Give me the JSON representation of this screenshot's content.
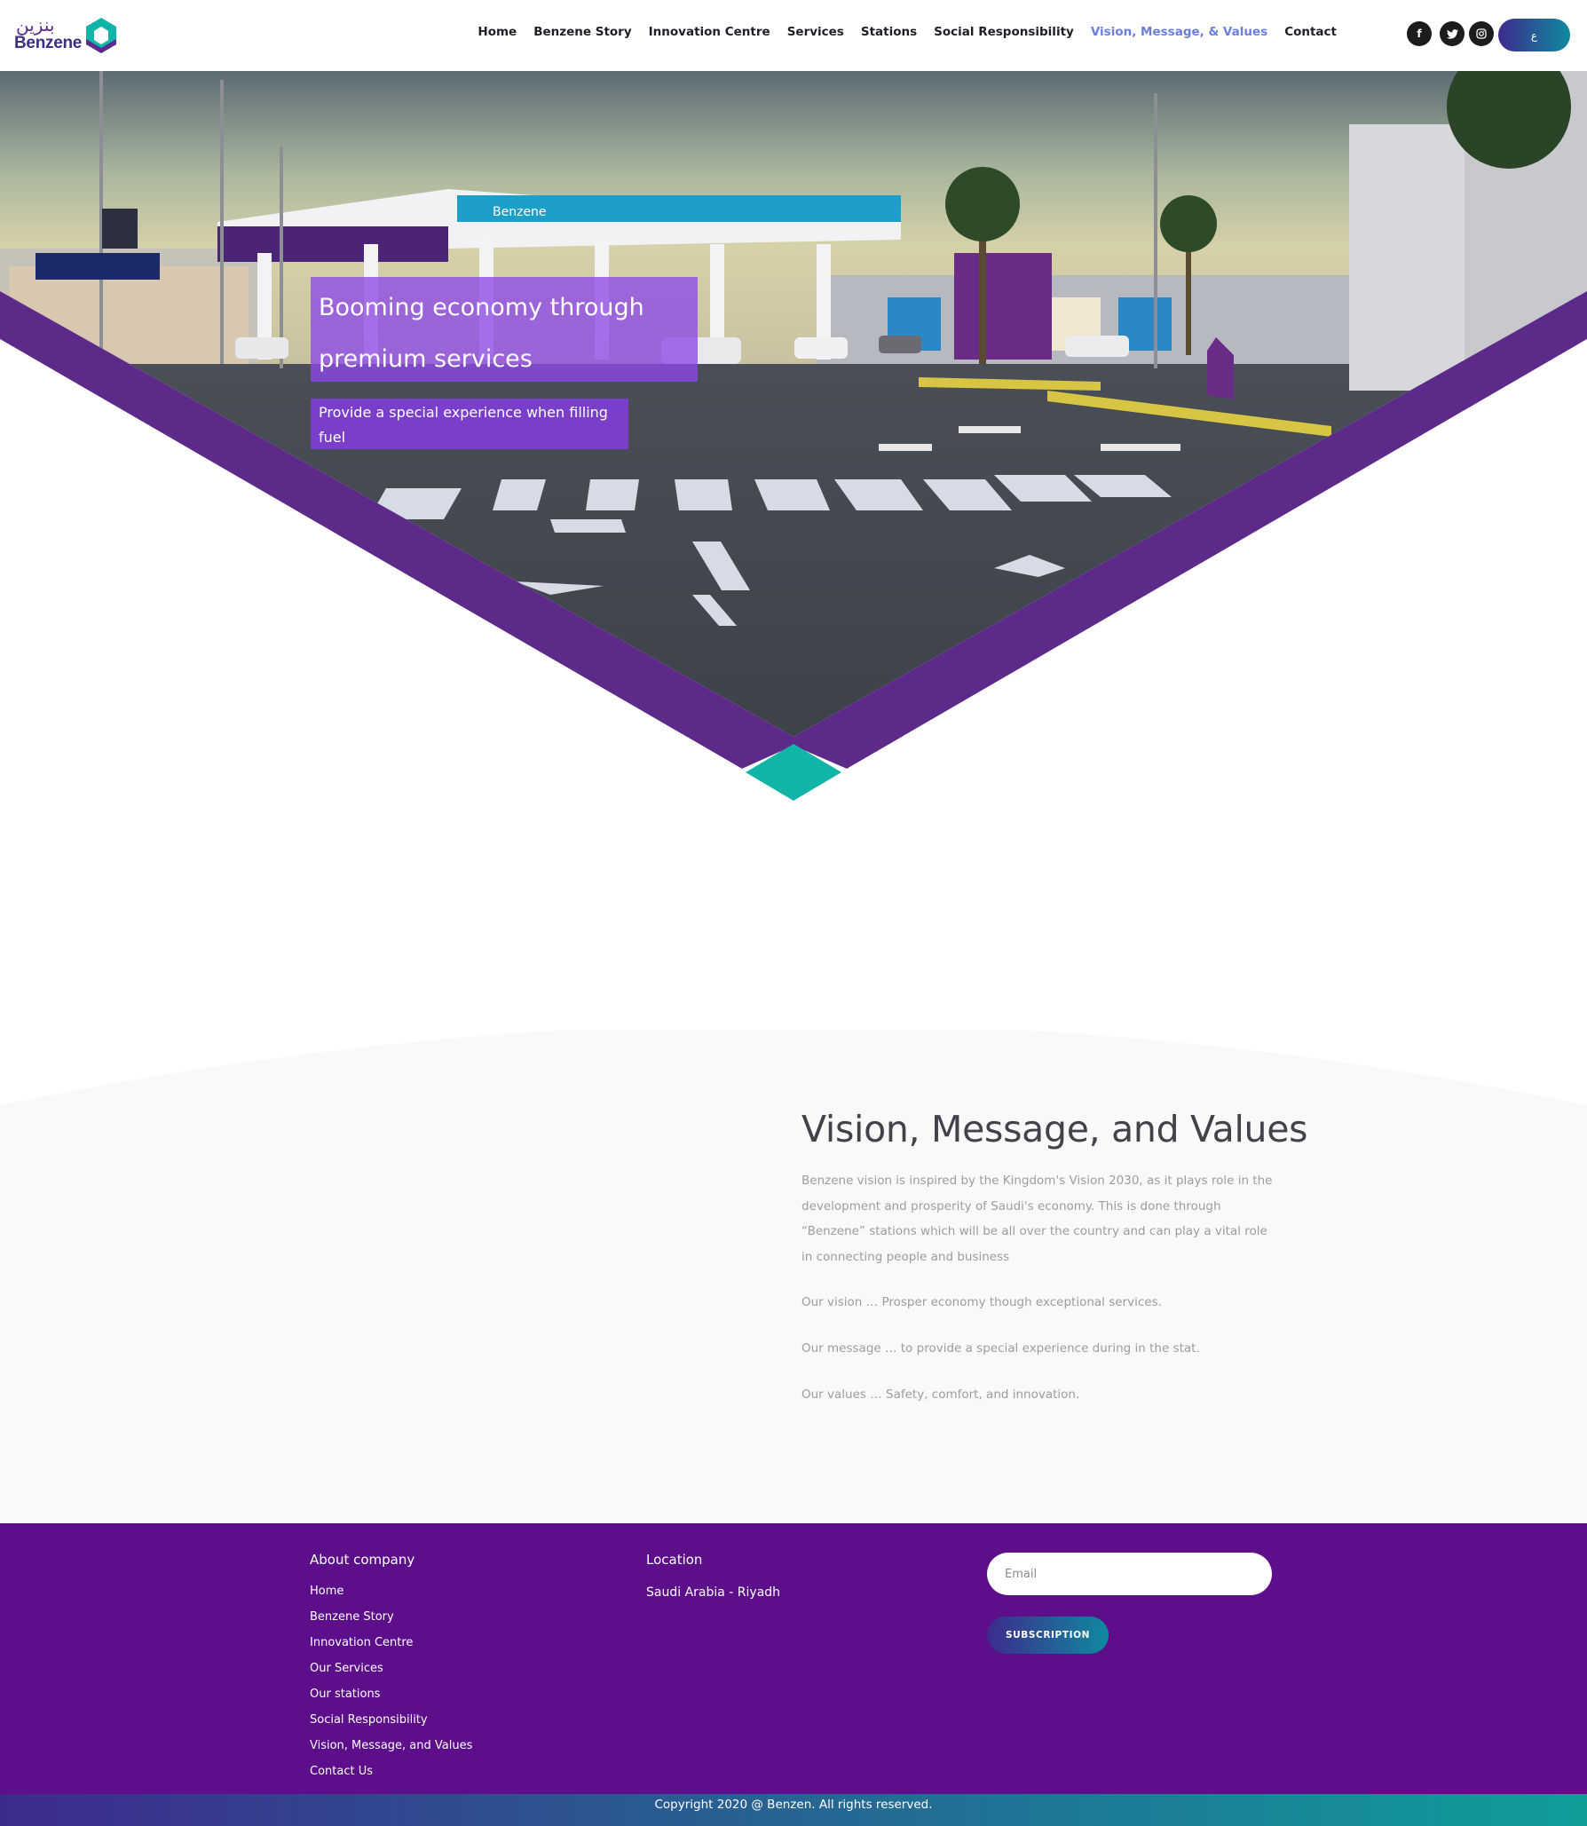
{
  "header": {
    "logo_text": "Benzene",
    "logo_arabic": "بنزين",
    "nav": [
      {
        "label": "Home"
      },
      {
        "label": "Benzene Story"
      },
      {
        "label": "Innovation Centre"
      },
      {
        "label": "Services"
      },
      {
        "label": "Stations"
      },
      {
        "label": "Social Responsibility"
      },
      {
        "label": "Vision, Message, & Values",
        "active": true
      },
      {
        "label": "Contact"
      }
    ],
    "social": [
      {
        "icon": "facebook-icon",
        "glyph": "f"
      },
      {
        "icon": "twitter-icon",
        "glyph": "t"
      },
      {
        "icon": "instagram-icon",
        "glyph": "◎"
      }
    ],
    "language_label": "ع"
  },
  "hero": {
    "title_line1": "Booming economy through",
    "title_line2": "premium services",
    "subtitle_line1": "Provide a special experience when filling",
    "subtitle_line2": "fuel",
    "station_sign": "Benzene"
  },
  "vision": {
    "title": "Vision, Message, and Values",
    "intro": "Benzene vision is inspired by the Kingdom's Vision 2030, as it plays role in the development and prosperity of Saudi's economy. This is done through “Benzene” stations which will be all over the country and can play a vital role in connecting people and business",
    "vision_line": "Our vision … Prosper economy though exceptional services.",
    "message_line": "Our message … to provide a special experience during in the stat.",
    "values_line": "Our values … Safety, comfort, and innovation."
  },
  "footer": {
    "about_heading": "About company",
    "links": [
      "Home",
      "Benzene Story",
      "Innovation Centre",
      "Our Services",
      "Our stations",
      "Social Responsibility",
      "Vision, Message, and Values",
      "Contact Us"
    ],
    "location_heading": "Location",
    "location": "Saudi Arabia - Riyadh",
    "email_placeholder": "Email",
    "subscribe_label": "SUBSCRIPTION",
    "copyright": "Copyright 2020 @ Benzen. All rights reserved."
  },
  "colors": {
    "brand_purple": "#5d0e8b",
    "chevron_purple": "#5e2a8a",
    "teal": "#0fb5a8",
    "nav_active": "#6c7fe0"
  }
}
